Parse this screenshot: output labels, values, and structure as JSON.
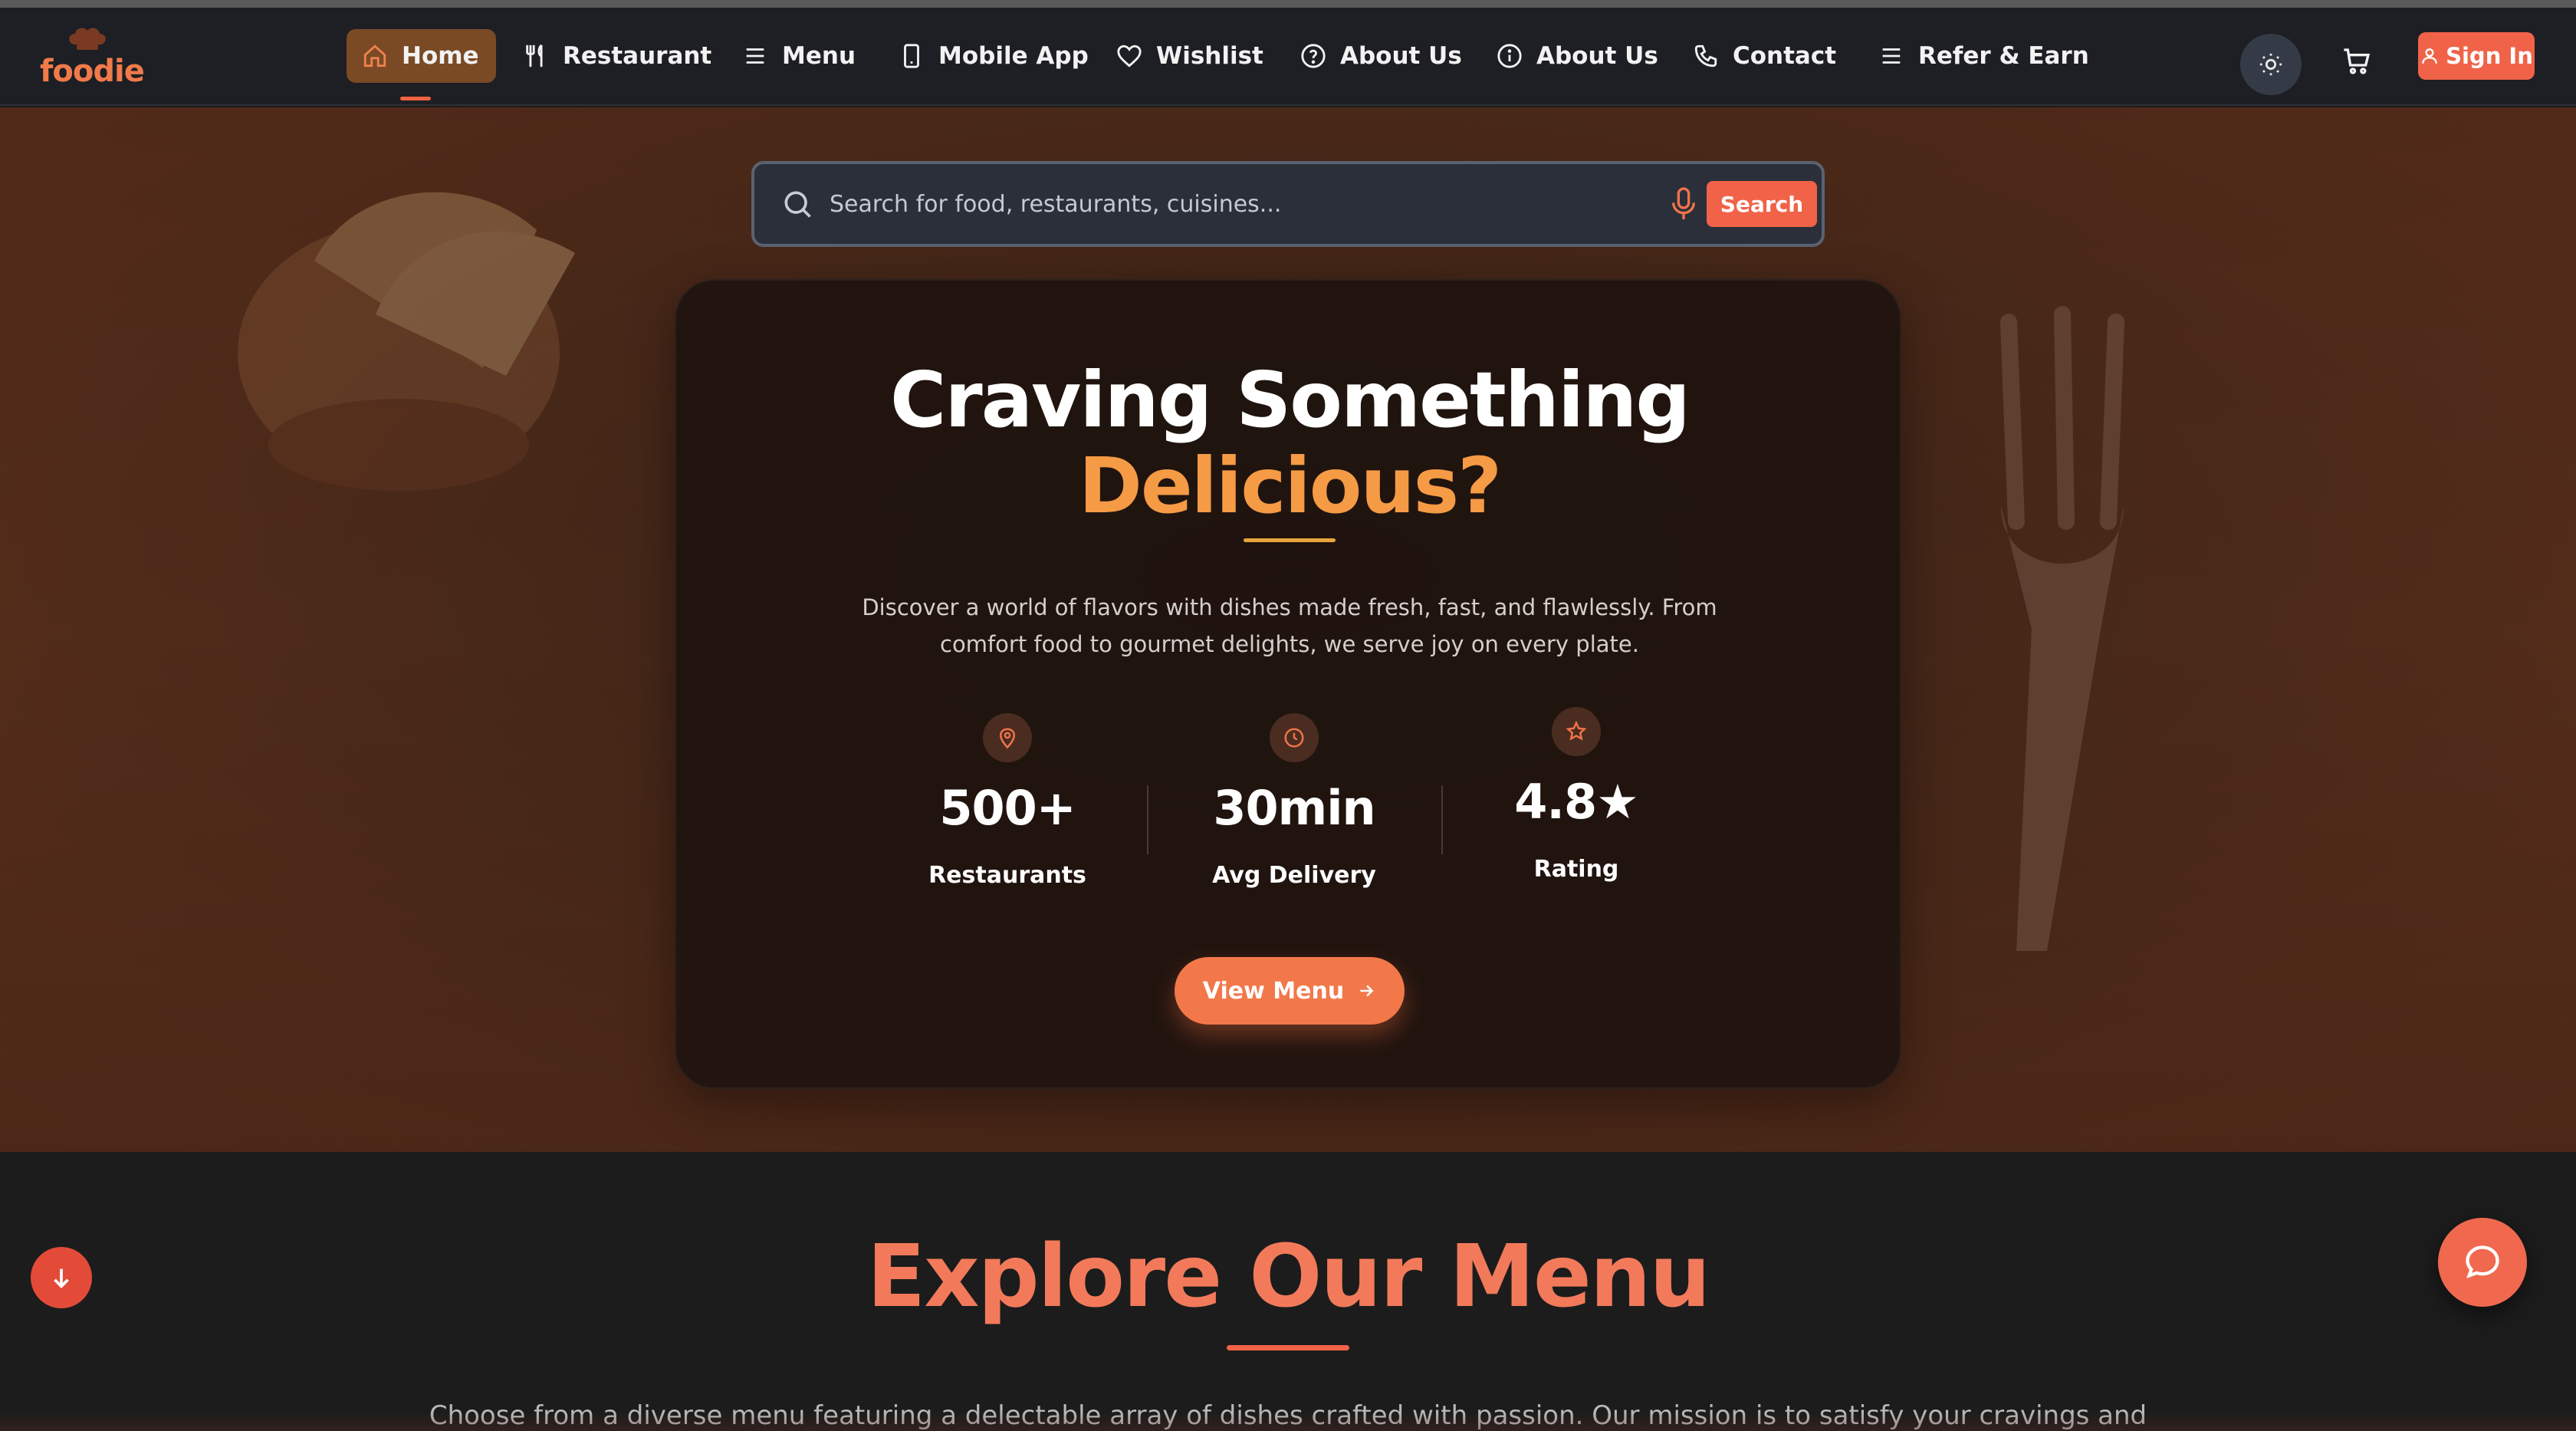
{
  "brand": {
    "name": "foodie",
    "accent": "#f06348",
    "highlight": "#f59a45"
  },
  "nav": {
    "items": [
      {
        "label": "Home",
        "icon": "home-icon",
        "active": true
      },
      {
        "label": "Restaurant",
        "icon": "utensils-icon"
      },
      {
        "label": "Menu",
        "icon": "menu-lines-icon"
      },
      {
        "label": "Mobile App",
        "icon": "smartphone-icon"
      },
      {
        "label": "Wishlist",
        "icon": "heart-icon"
      },
      {
        "label": "About Us",
        "icon": "help-circle-icon"
      },
      {
        "label": "About Us",
        "icon": "info-circle-icon"
      },
      {
        "label": "Contact",
        "icon": "phone-icon"
      },
      {
        "label": "Refer & Earn",
        "icon": "menu-lines-icon"
      }
    ],
    "theme_icon": "sun-icon",
    "cart_icon": "cart-icon",
    "signin_label": "Sign In"
  },
  "search": {
    "placeholder": "Search for food, restaurants, cuisines...",
    "button_label": "Search",
    "mic_icon": "microphone-icon"
  },
  "hero": {
    "title_line1": "Craving Something",
    "title_line2": "Delicious?",
    "description": "Discover a world of flavors with dishes made fresh, fast, and flawlessly. From comfort food to gourmet delights, we serve joy on every plate.",
    "stats": [
      {
        "value": "500+",
        "label": "Restaurants",
        "icon": "map-pin-icon"
      },
      {
        "value": "30min",
        "label": "Avg Delivery",
        "icon": "clock-icon"
      },
      {
        "value": "4.8★",
        "label": "Rating",
        "icon": "star-icon"
      }
    ],
    "cta_label": "View Menu"
  },
  "explore": {
    "title": "Explore Our Menu",
    "description": "Choose from a diverse menu featuring a delectable array of dishes crafted with passion. Our mission is to satisfy your cravings and"
  }
}
